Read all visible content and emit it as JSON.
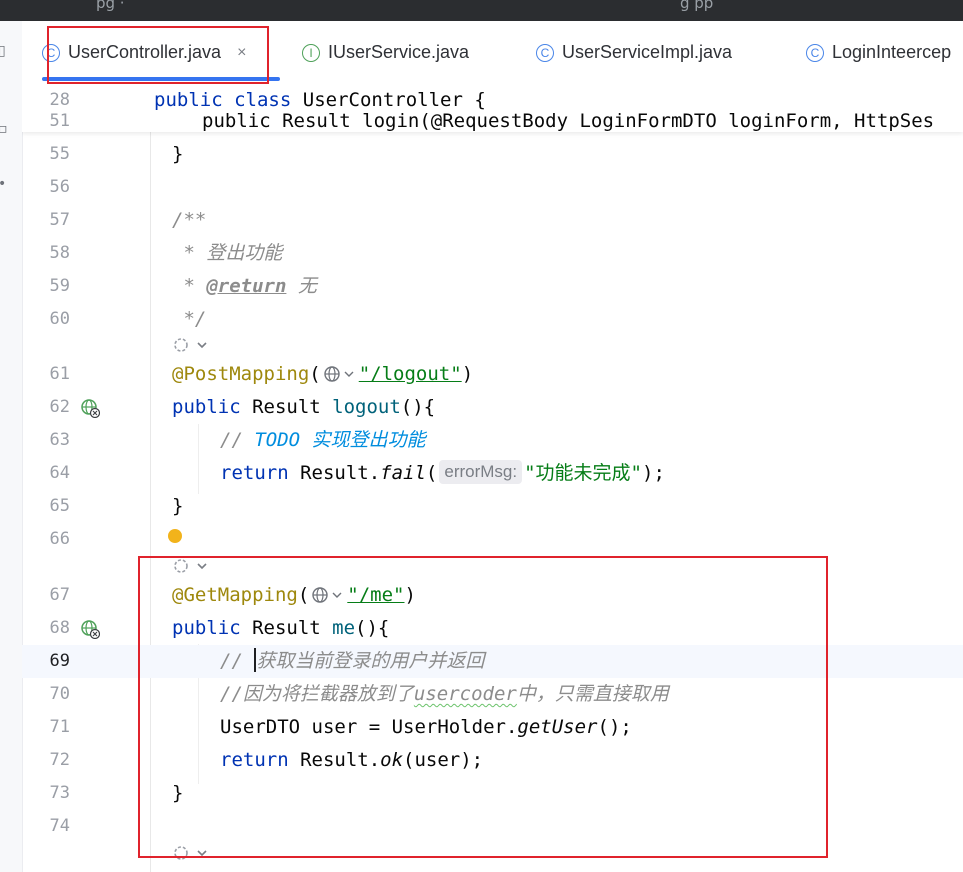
{
  "top_strip": {
    "ghost_left": "pg  ·",
    "ghost_mid": "g  pp"
  },
  "tabs": [
    {
      "label": "UserController.java",
      "icon": "class-icon",
      "icon_glyph": "C",
      "active": true,
      "close": "×"
    },
    {
      "label": "IUserService.java",
      "icon": "interface-icon",
      "icon_glyph": "I",
      "active": false
    },
    {
      "label": "UserServiceImpl.java",
      "icon": "class-icon",
      "icon_glyph": "C",
      "active": false
    },
    {
      "label": "LoginInteercep",
      "icon": "class-icon",
      "icon_glyph": "C",
      "active": false
    }
  ],
  "sticky": {
    "line1_number": "28",
    "line1": {
      "kw1": "public",
      "kw2": "class",
      "name": "UserController",
      "brace": "{"
    },
    "line2_number": "51",
    "line2": "public Result login(@RequestBody LoginFormDTO loginForm, HttpSes"
  },
  "lines": {
    "l55": {
      "num": "55",
      "text": "}"
    },
    "l56": {
      "num": "56"
    },
    "l57": {
      "num": "57",
      "text": "/**"
    },
    "l58": {
      "num": "58",
      "text": " * 登出功能"
    },
    "l59": {
      "num": "59",
      "star": " * ",
      "tag": "@return",
      "rest": " 无"
    },
    "l60": {
      "num": "60",
      "text": " */"
    },
    "l61": {
      "num": "61",
      "ann": "@PostMapping",
      "open": "(",
      "str": "\"/logout\"",
      "close": ")"
    },
    "l62": {
      "num": "62",
      "kw": "public",
      "mid": " Result ",
      "fn": "logout",
      "rest": "(){"
    },
    "l63": {
      "num": "63",
      "slash": "// ",
      "todo": "TODO",
      "rest": " 实现登出功能"
    },
    "l64": {
      "num": "64",
      "kw": "return",
      "mid": " Result.",
      "fn": "fail",
      "open": "(",
      "hint": "errorMsg:",
      "str": "\"功能未完成\"",
      "close": ");"
    },
    "l65": {
      "num": "65",
      "text": "}"
    },
    "l66": {
      "num": "66"
    },
    "l67": {
      "num": "67",
      "ann": "@GetMapping",
      "open": "(",
      "str": "\"/me\"",
      "close": ")"
    },
    "l68": {
      "num": "68",
      "kw": "public",
      "mid": " Result ",
      "fn": "me",
      "rest": "(){"
    },
    "l69": {
      "num": "69",
      "slash": "// ",
      "rest": "获取当前登录的用户并返回"
    },
    "l70": {
      "num": "70",
      "pre": "//因为将拦截器放到了",
      "squig": "usercoder",
      "post": "中，只需直接取用"
    },
    "l71": {
      "num": "71",
      "pre": "UserDTO user = UserHolder.",
      "fn": "getUser",
      "post": "();"
    },
    "l72": {
      "num": "72",
      "kw": "return",
      "mid": " Result.",
      "fn": "ok",
      "post": "(user);"
    },
    "l73": {
      "num": "73",
      "text": "}"
    },
    "l74": {
      "num": "74"
    }
  },
  "colors": {
    "annotation_red": "#e0232c",
    "accent": "#3574f0",
    "keyword": "#0033b3",
    "annotation": "#9e880d",
    "string": "#067d17",
    "comment": "#8c8c8c"
  }
}
